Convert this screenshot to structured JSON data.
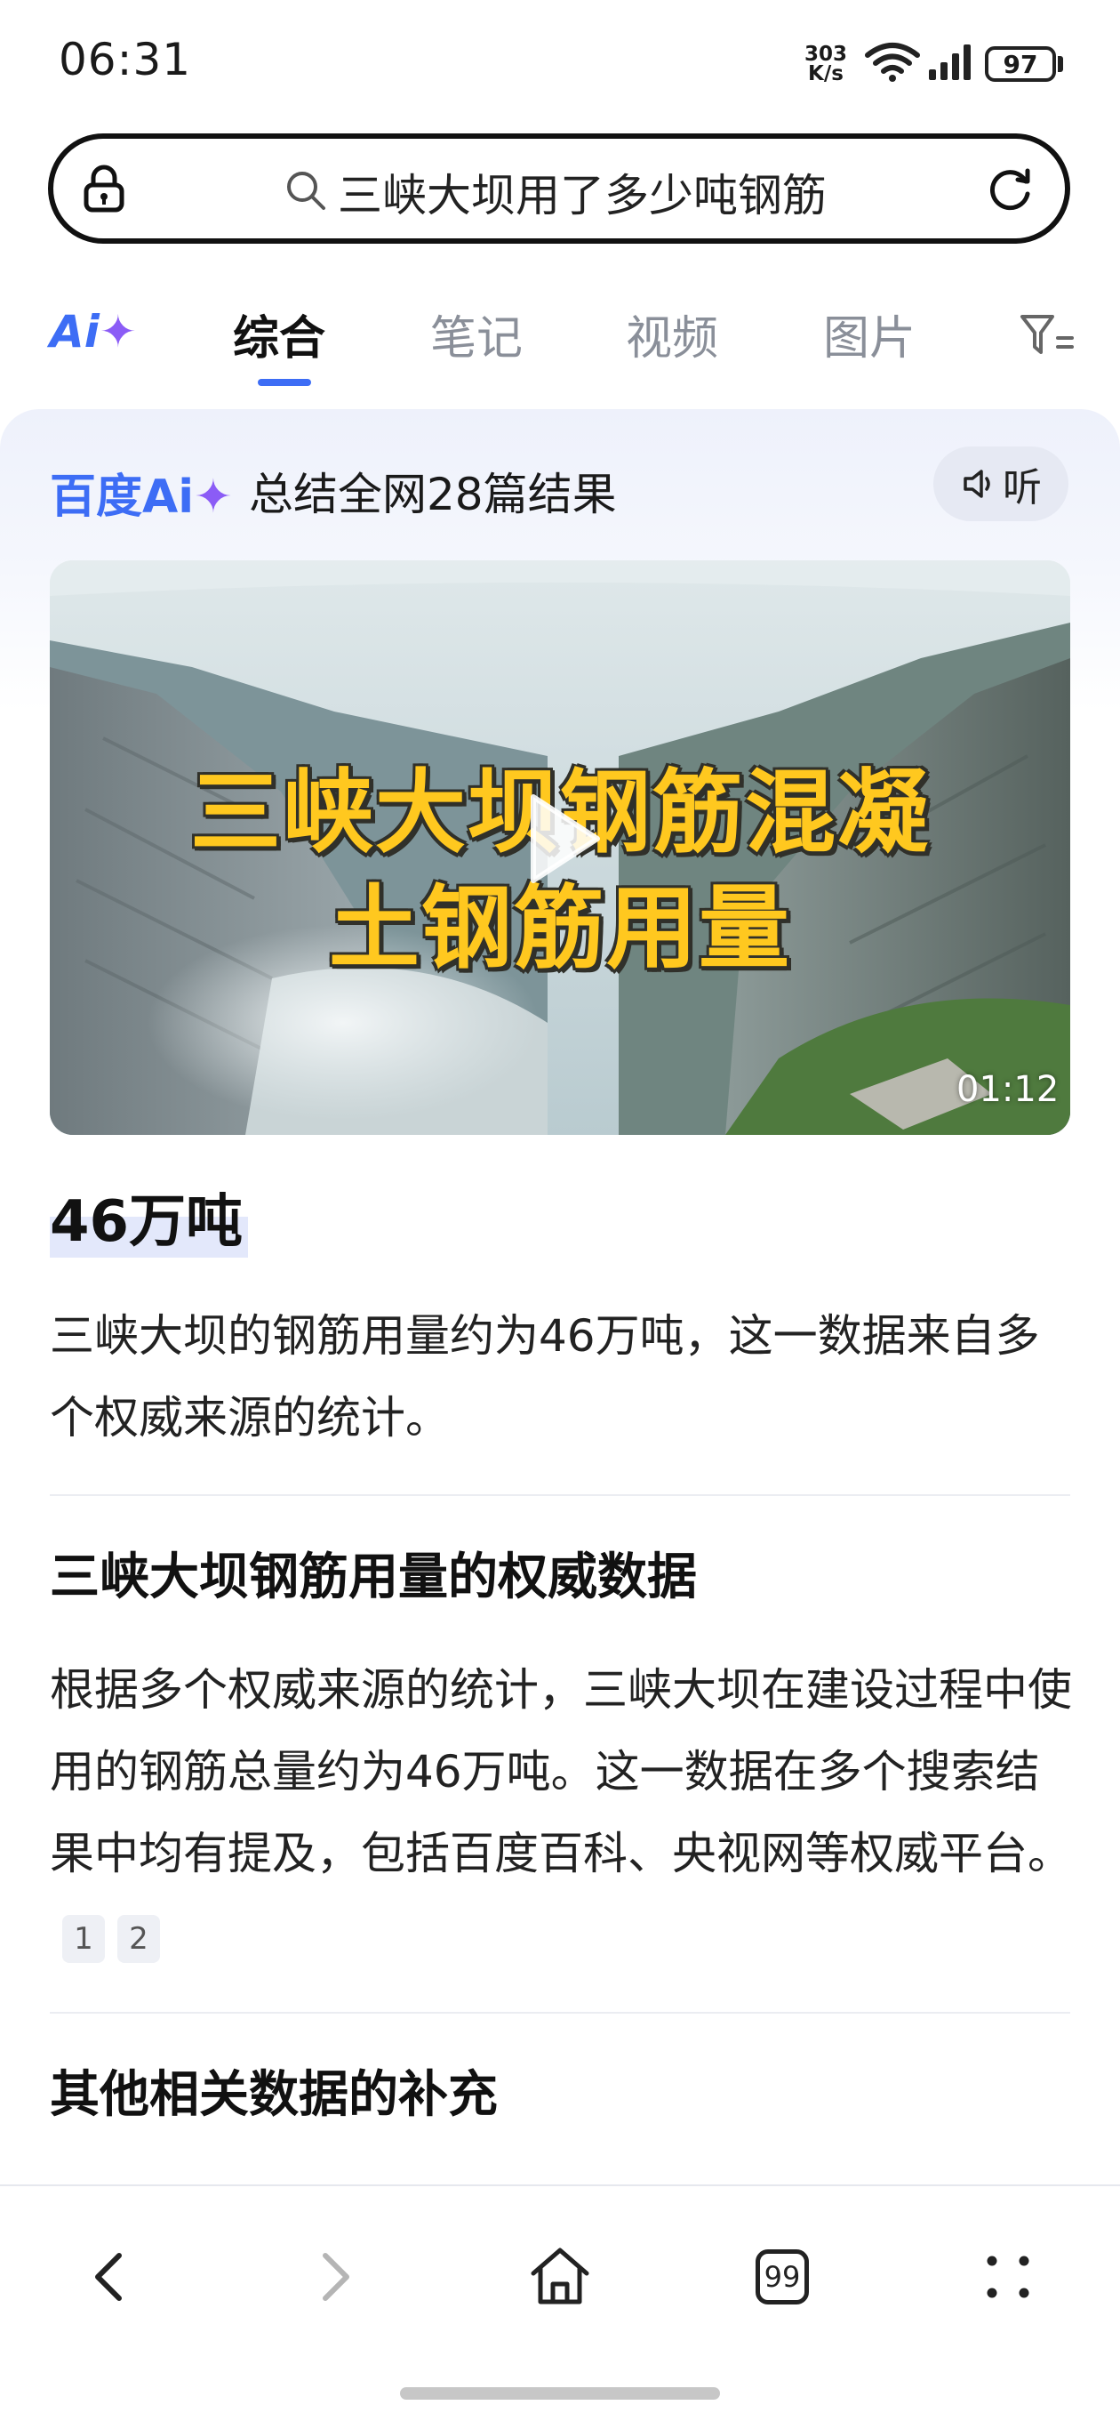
{
  "status_bar": {
    "time": "06:31",
    "net_speed_value": "303",
    "net_speed_unit": "K/s",
    "battery": "97",
    "icons": [
      "wifi-icon",
      "signal-icon",
      "battery-icon"
    ]
  },
  "search": {
    "query": "三峡大坝用了多少吨钢筋",
    "icons": [
      "lock-icon",
      "search-icon",
      "refresh-icon"
    ]
  },
  "tabs": {
    "ai": "Ai",
    "items": [
      {
        "label": "综合",
        "active": true
      },
      {
        "label": "笔记",
        "active": false
      },
      {
        "label": "视频",
        "active": false
      },
      {
        "label": "图片",
        "active": false
      }
    ],
    "filter_icon": "filter-icon"
  },
  "ai_card": {
    "brand": "百度Ai",
    "summary": "总结全网28篇结果",
    "listen_label": "听"
  },
  "video": {
    "title_line1": "三峡大坝钢筋混凝",
    "title_line2": "土钢筋用量",
    "duration": "01:12"
  },
  "answer": {
    "headline": "46万吨",
    "intro": "三峡大坝的钢筋用量约为46万吨，这一数据来自多个权威来源的统计。",
    "section1_title": "三峡大坝钢筋用量的权威数据",
    "section1_text": "根据多个权威来源的统计，三峡大坝在建设过程中使用的钢筋总量约为46万吨。这一数据在多个搜索结果中均有提及，包括百度百科、央视网等权威平台。",
    "citations": [
      "1",
      "2"
    ],
    "section2_title": "其他相关数据的补充"
  },
  "bottom_nav": {
    "tab_count": "99",
    "icons": [
      "back-icon",
      "forward-icon",
      "home-icon",
      "tabs-icon",
      "more-icon"
    ]
  },
  "colors": {
    "accent": "#3d6df5",
    "ai_spark": "#8b5cf6",
    "video_title": "#ffc81f"
  }
}
